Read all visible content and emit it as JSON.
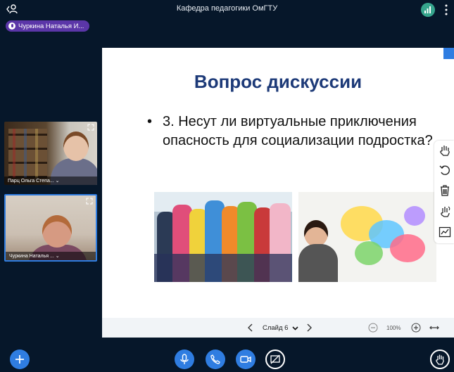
{
  "header": {
    "title": "Кафедра педагогики ОмГТУ",
    "users_icon": "users-icon",
    "signal_icon": "connection-status-icon",
    "menu_icon": "more-vertical-icon"
  },
  "talking_indicator": {
    "name": "Чуркина Наталья И..."
  },
  "videos": [
    {
      "name": "Парц Ольга Степа..."
    },
    {
      "name": "Чуркина Наталья ..."
    }
  ],
  "slide": {
    "title": "Вопрос дискуссии",
    "bullet_marker": "•",
    "bullet_text": "3. Несут ли виртуальные приключения опасность для социализации подростка?"
  },
  "slide_footer": {
    "slide_label": "Слайд 6",
    "zoom": "100%"
  },
  "toolbar": {
    "tools": [
      "hand-tool-icon",
      "undo-icon",
      "trash-icon",
      "multi-user-pen-icon",
      "whiteboard-icon"
    ]
  },
  "colors": {
    "background": "#06172a",
    "accent": "#2f7de1",
    "talking": "#5b36a8",
    "title": "#1d3a78"
  }
}
